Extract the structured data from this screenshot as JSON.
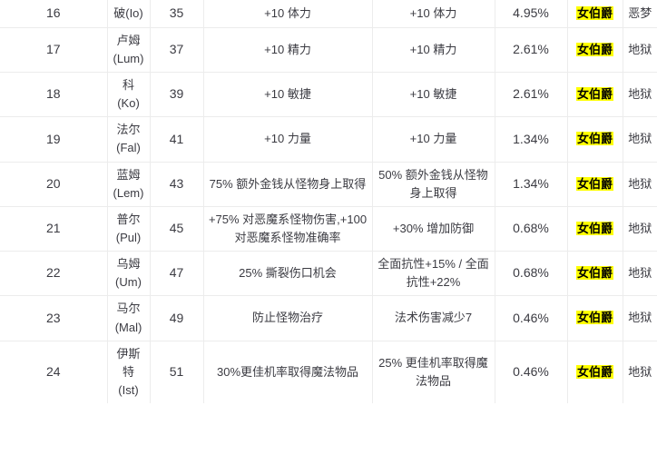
{
  "table": {
    "columns": [
      {
        "key": "index",
        "name": "index-column"
      },
      {
        "key": "rune",
        "name": "rune-name-column"
      },
      {
        "key": "level",
        "name": "required-level-column"
      },
      {
        "key": "weapon",
        "name": "weapon-effect-column"
      },
      {
        "key": "armor",
        "name": "armor-effect-column"
      },
      {
        "key": "percent",
        "name": "drop-rate-column"
      },
      {
        "key": "source",
        "name": "source-column"
      },
      {
        "key": "difficulty",
        "name": "difficulty-column"
      }
    ],
    "highlight_color": "#ffff00",
    "border_color": "#ececec",
    "rows": [
      {
        "index": "16",
        "rune": "破(Io)",
        "level": "35",
        "weapon": "+10 体力",
        "armor": "+10 体力",
        "percent": "4.95%",
        "source": "女伯爵",
        "difficulty": "恶梦"
      },
      {
        "index": "17",
        "rune": "卢姆 (Lum)",
        "level": "37",
        "weapon": "+10 精力",
        "armor": "+10 精力",
        "percent": "2.61%",
        "source": "女伯爵",
        "difficulty": "地狱"
      },
      {
        "index": "18",
        "rune": "科(Ko)",
        "level": "39",
        "weapon": "+10 敏捷",
        "armor": "+10 敏捷",
        "percent": "2.61%",
        "source": "女伯爵",
        "difficulty": "地狱"
      },
      {
        "index": "19",
        "rune": "法尔 (Fal)",
        "level": "41",
        "weapon": "+10 力量",
        "armor": "+10 力量",
        "percent": "1.34%",
        "source": "女伯爵",
        "difficulty": "地狱"
      },
      {
        "index": "20",
        "rune": "蓝姆 (Lem)",
        "level": "43",
        "weapon": "75% 额外金钱从怪物身上取得",
        "armor": "50% 额外金钱从怪物身上取得",
        "percent": "1.34%",
        "source": "女伯爵",
        "difficulty": "地狱"
      },
      {
        "index": "21",
        "rune": "普尔 (Pul)",
        "level": "45",
        "weapon": "+75% 对恶魔系怪物伤害,+100对恶魔系怪物准确率",
        "armor": "+30% 增加防御",
        "percent": "0.68%",
        "source": "女伯爵",
        "difficulty": "地狱"
      },
      {
        "index": "22",
        "rune": "乌姆 (Um)",
        "level": "47",
        "weapon": "25% 撕裂伤口机会",
        "armor": "全面抗性+15% / 全面抗性+22%",
        "percent": "0.68%",
        "source": "女伯爵",
        "difficulty": "地狱"
      },
      {
        "index": "23",
        "rune": "马尔 (Mal)",
        "level": "49",
        "weapon": "防止怪物治疗",
        "armor": "法术伤害减少7",
        "percent": "0.46%",
        "source": "女伯爵",
        "difficulty": "地狱"
      },
      {
        "index": "24",
        "rune": "伊斯特 (Ist)",
        "level": "51",
        "weapon": "30%更佳机率取得魔法物品",
        "armor": "25% 更佳机率取得魔法物品",
        "percent": "0.46%",
        "source": "女伯爵",
        "difficulty": "地狱"
      }
    ]
  }
}
